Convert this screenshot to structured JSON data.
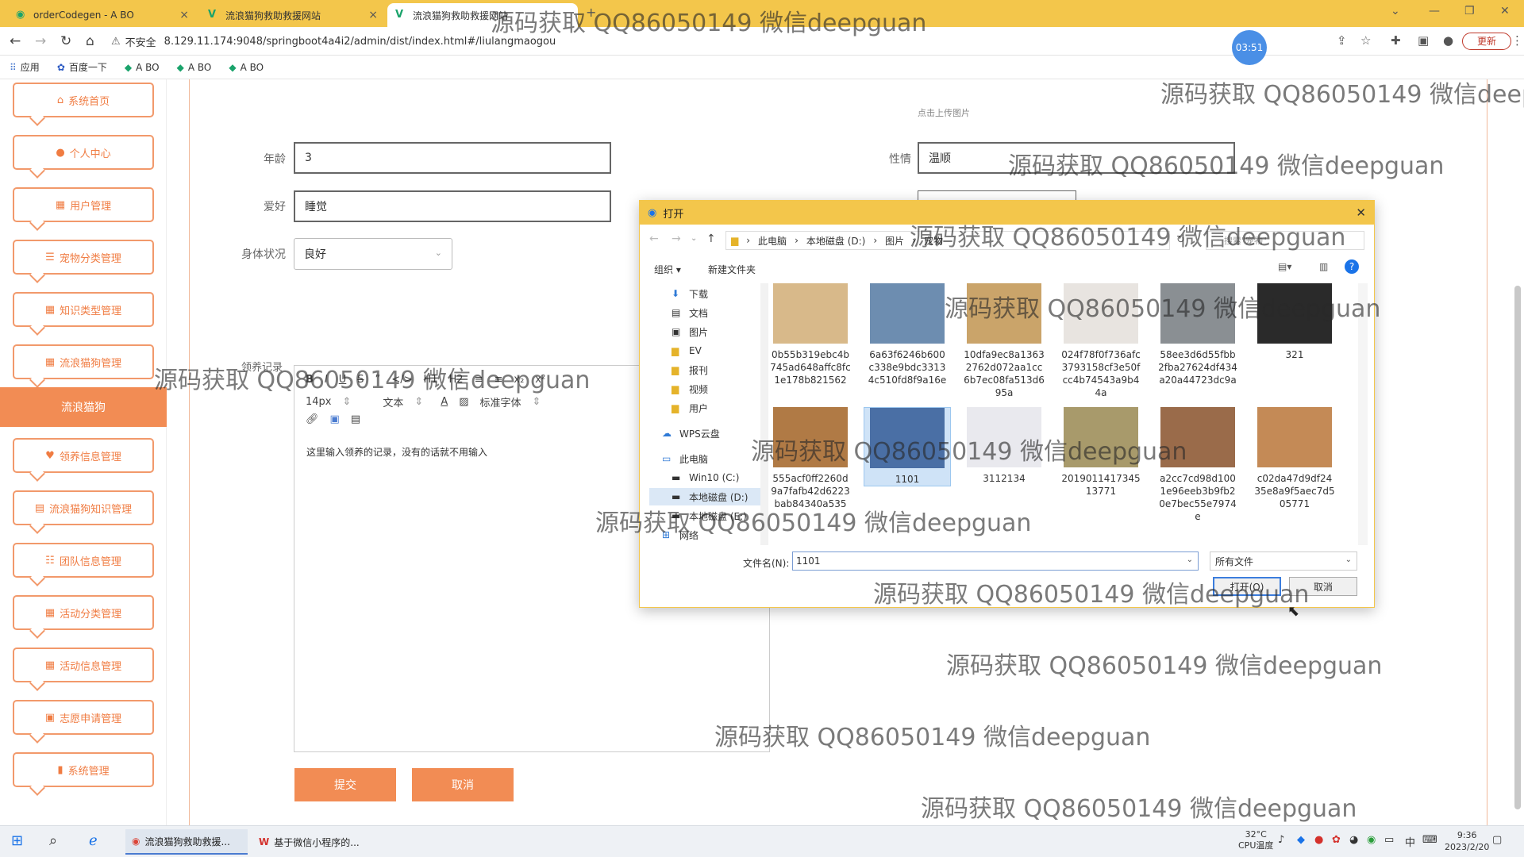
{
  "browser": {
    "tabs": [
      {
        "label": "orderCodegen - A BO",
        "active": false
      },
      {
        "label": "流浪猫狗救助救援网站",
        "active": false
      },
      {
        "label": "流浪猫狗救助救援网站",
        "active": true
      }
    ],
    "security": "不安全",
    "url": "8.129.11.174:9048/springboot4a4i2/admin/dist/index.html#/liulangmaogou",
    "timer": "03:51",
    "update_label": "更新",
    "bookmarks": [
      "应用",
      "百度一下",
      "A BO",
      "A BO",
      "A BO"
    ]
  },
  "sidebar": {
    "items": [
      {
        "label": "系统首页",
        "icon": "home-icon"
      },
      {
        "label": "个人中心",
        "icon": "user-icon"
      },
      {
        "label": "用户管理",
        "icon": "grid-icon"
      },
      {
        "label": "宠物分类管理",
        "icon": "list-icon"
      },
      {
        "label": "知识类型管理",
        "icon": "grid-icon"
      },
      {
        "label": "流浪猫狗管理",
        "icon": "grid-icon"
      },
      {
        "label": "领养信息管理",
        "icon": "heart-icon"
      },
      {
        "label": "流浪猫狗知识管理",
        "icon": "book-icon"
      },
      {
        "label": "团队信息管理",
        "icon": "sliders-icon"
      },
      {
        "label": "活动分类管理",
        "icon": "grid-icon"
      },
      {
        "label": "活动信息管理",
        "icon": "grid-icon"
      },
      {
        "label": "志愿申请管理",
        "icon": "calendar-icon"
      },
      {
        "label": "系统管理",
        "icon": "bar-chart-icon"
      }
    ],
    "active_label": "流浪猫狗"
  },
  "form": {
    "upload_hint": "点击上传图片",
    "age_label": "年龄",
    "age_value": "3",
    "hobby_label": "爱好",
    "hobby_value": "睡觉",
    "health_label": "身体状况",
    "health_value": "良好",
    "temper_label": "性情",
    "temper_value": "温顺",
    "record_label": "领养记录",
    "editor_toolbar_row1": [
      "B",
      "I",
      "U",
      "S",
      "”",
      "</>",
      "H1",
      "H2",
      "≡",
      "≡",
      "x₂",
      "x²"
    ],
    "editor_font_size": "14px",
    "editor_text_type": "文本",
    "editor_font_family": "标准字体",
    "editor_content": "这里输入领养的记录，没有的话就不用输入",
    "submit_label": "提交",
    "cancel_label": "取消"
  },
  "dialog": {
    "title": "打开",
    "breadcrumbs": [
      "此电脑",
      "本地磁盘 (D:)",
      "图片",
      "宠物"
    ],
    "search_placeholder": "搜索\"宠物\"",
    "organize_label": "组织 ▾",
    "new_folder_label": "新建文件夹",
    "tree": [
      {
        "label": "下载",
        "icon": "download-icon"
      },
      {
        "label": "文档",
        "icon": "document-icon"
      },
      {
        "label": "图片",
        "icon": "image-icon"
      },
      {
        "label": "EV",
        "icon": "folder-icon"
      },
      {
        "label": "报刊",
        "icon": "folder-icon"
      },
      {
        "label": "视频",
        "icon": "folder-icon"
      },
      {
        "label": "用户",
        "icon": "folder-icon"
      },
      {
        "label": "WPS云盘",
        "icon": "cloud-icon"
      },
      {
        "label": "此电脑",
        "icon": "computer-icon"
      },
      {
        "label": "Win10 (C:)",
        "icon": "drive-icon"
      },
      {
        "label": "本地磁盘 (D:)",
        "icon": "drive-icon"
      },
      {
        "label": "本地磁盘 (E:)",
        "icon": "drive-icon"
      },
      {
        "label": "网络",
        "icon": "network-icon"
      }
    ],
    "files": [
      {
        "name": "0b55b319ebc4b745ad648affc8fc1e178b821562",
        "color": "#d8b98a"
      },
      {
        "name": "6a63f6246b600c338e9bdc33134c510fd8f9a16e",
        "color": "#6d8db0"
      },
      {
        "name": "10dfa9ec8a13632762d072aa1cc6b7ec08fa513d695a",
        "color": "#caa46a"
      },
      {
        "name": "024f78f0f736afc3793158cf3e50fcc4b74543a9b44a",
        "color": "#e8e4e0"
      },
      {
        "name": "58ee3d6d55fbb2fba27624df434a20a44723dc9a",
        "color": "#8a8f93"
      },
      {
        "name": "321",
        "color": "#2a2a2a"
      },
      {
        "name": "555acf0ff2260d9a7fafb42d6223bab84340a535",
        "color": "#b07a45"
      },
      {
        "name": "1101",
        "color": "#4a6fa5",
        "selected": true
      },
      {
        "name": "3112134",
        "color": "#e9e9ee"
      },
      {
        "name": "201901141734513771",
        "color": "#a89a6b"
      },
      {
        "name": "a2cc7cd98d1001e96eeb3b9fb20e7bec55e7974e",
        "color": "#9a6b4a"
      },
      {
        "name": "c02da47d9df2435e8a9f5aec7d505771",
        "color": "#c48a56"
      }
    ],
    "filename_label": "文件名(N):",
    "filename_value": "1101",
    "filetype_value": "所有文件",
    "open_label": "打开(O)",
    "cancel_label": "取消"
  },
  "watermark": "源码获取 QQ86050149 微信deepguan",
  "taskbar": {
    "items": [
      "流浪猫狗救助救援...",
      "基于微信小程序的..."
    ],
    "temperature": "32°C",
    "temp_label": "CPU温度",
    "ime": "中",
    "time": "9:36",
    "date": "2023/2/20"
  },
  "colors": {
    "accent": "#f28c54",
    "tab_bar": "#f3c64b"
  }
}
